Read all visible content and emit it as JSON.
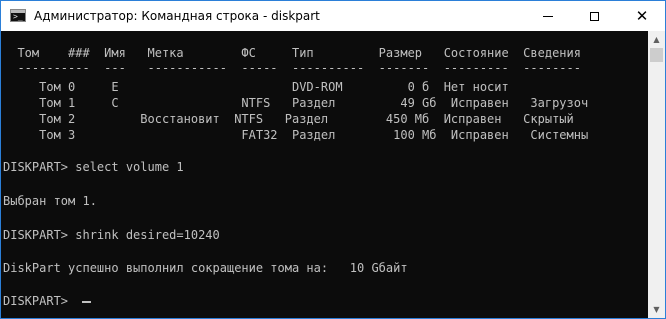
{
  "window": {
    "title": "Администратор: Командная строка - diskpart",
    "icon_name": "cmd-icon",
    "controls": {
      "minimize": "minimize-icon",
      "maximize": "maximize-icon",
      "close": "close-icon"
    }
  },
  "console": {
    "lines": [
      "",
      "  Том    ###  Имя   Метка        ФС     Тип         Размер   Состояние  Сведения",
      "  ----------  ---   -----------  -----  ----------  -------  ---------  --------",
      "     Том 0     E                        DVD-ROM         0 б  Нет носит",
      "     Том 1     C                 NTFS   Раздел         49 Gб  Исправен   Загрузоч",
      "     Том 2         Восстановит  NTFS   Раздел        450 Мб  Исправен   Скрытый",
      "     Том 3                       FAT32  Раздел        100 Мб  Исправен   Системны",
      "",
      "DISKPART> select volume 1",
      "",
      "Выбран том 1.",
      "",
      "DISKPART> shrink desired=10240",
      "",
      "DiskPart успешно выполнил сокращение тома на:   10 Gбайт",
      "",
      "DISKPART> "
    ]
  },
  "colors": {
    "console_bg": "#0c0c0c",
    "console_fg": "#c0c0c0",
    "titlebar_bg": "#ffffff",
    "border": "#2b7fd8"
  }
}
